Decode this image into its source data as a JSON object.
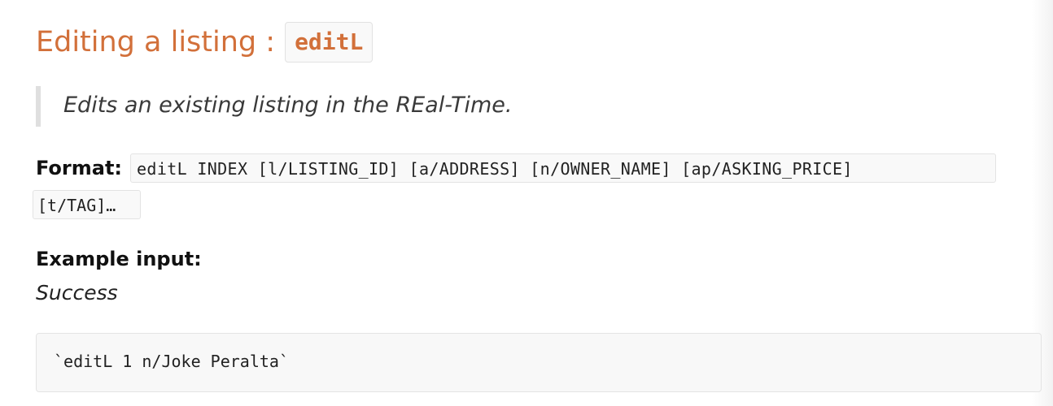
{
  "section": {
    "heading_text": "Editing a listing :",
    "heading_code": "editL",
    "description": "Edits an existing listing in the REal-Time.",
    "format_label": "Format:",
    "format_code_line1": "editL INDEX [l/LISTING_ID] [a/ADDRESS] [n/OWNER_NAME] [ap/ASKING_PRICE]",
    "format_code_line2": "[t/TAG]…",
    "example_label": "Example input:",
    "success_label": "Success",
    "example_code": "`editL 1 n/Joke Peralta`"
  },
  "colors": {
    "heading": "#d2703a",
    "quote_border": "#dfdfdf",
    "code_background": "#f9f9f9"
  }
}
